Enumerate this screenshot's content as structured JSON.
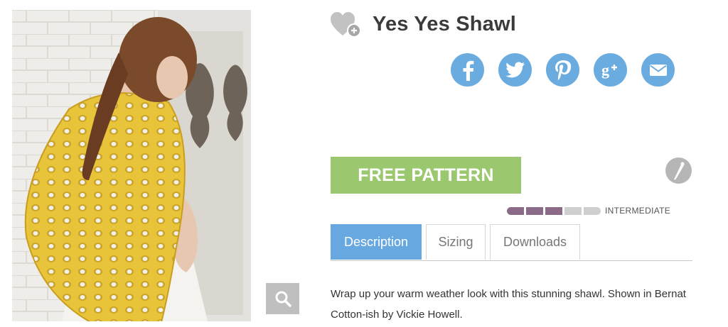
{
  "product": {
    "title": "Yes Yes Shawl",
    "cta_label": "FREE PATTERN",
    "skill": {
      "label": "INTERMEDIATE",
      "level": 3,
      "max": 5
    },
    "description": "Wrap up your warm weather look with this stunning shawl. Shown in Bernat Cotton-ish by Vickie Howell."
  },
  "tabs": [
    {
      "label": "Description",
      "active": true
    },
    {
      "label": "Sizing",
      "active": false
    },
    {
      "label": "Downloads",
      "active": false
    }
  ],
  "social": [
    "facebook-icon",
    "twitter-icon",
    "pinterest-icon",
    "google-plus-icon",
    "email-icon"
  ],
  "icons": {
    "favorite": "heart-plus-icon",
    "zoom": "search-icon",
    "craft": "crochet-hook-icon"
  },
  "colors": {
    "accent_blue": "#68a8e0",
    "social_blue": "#6bace0",
    "cta_green": "#9bc86e",
    "skill_on": "#8c6b88",
    "skill_off": "#cfcfcf"
  }
}
